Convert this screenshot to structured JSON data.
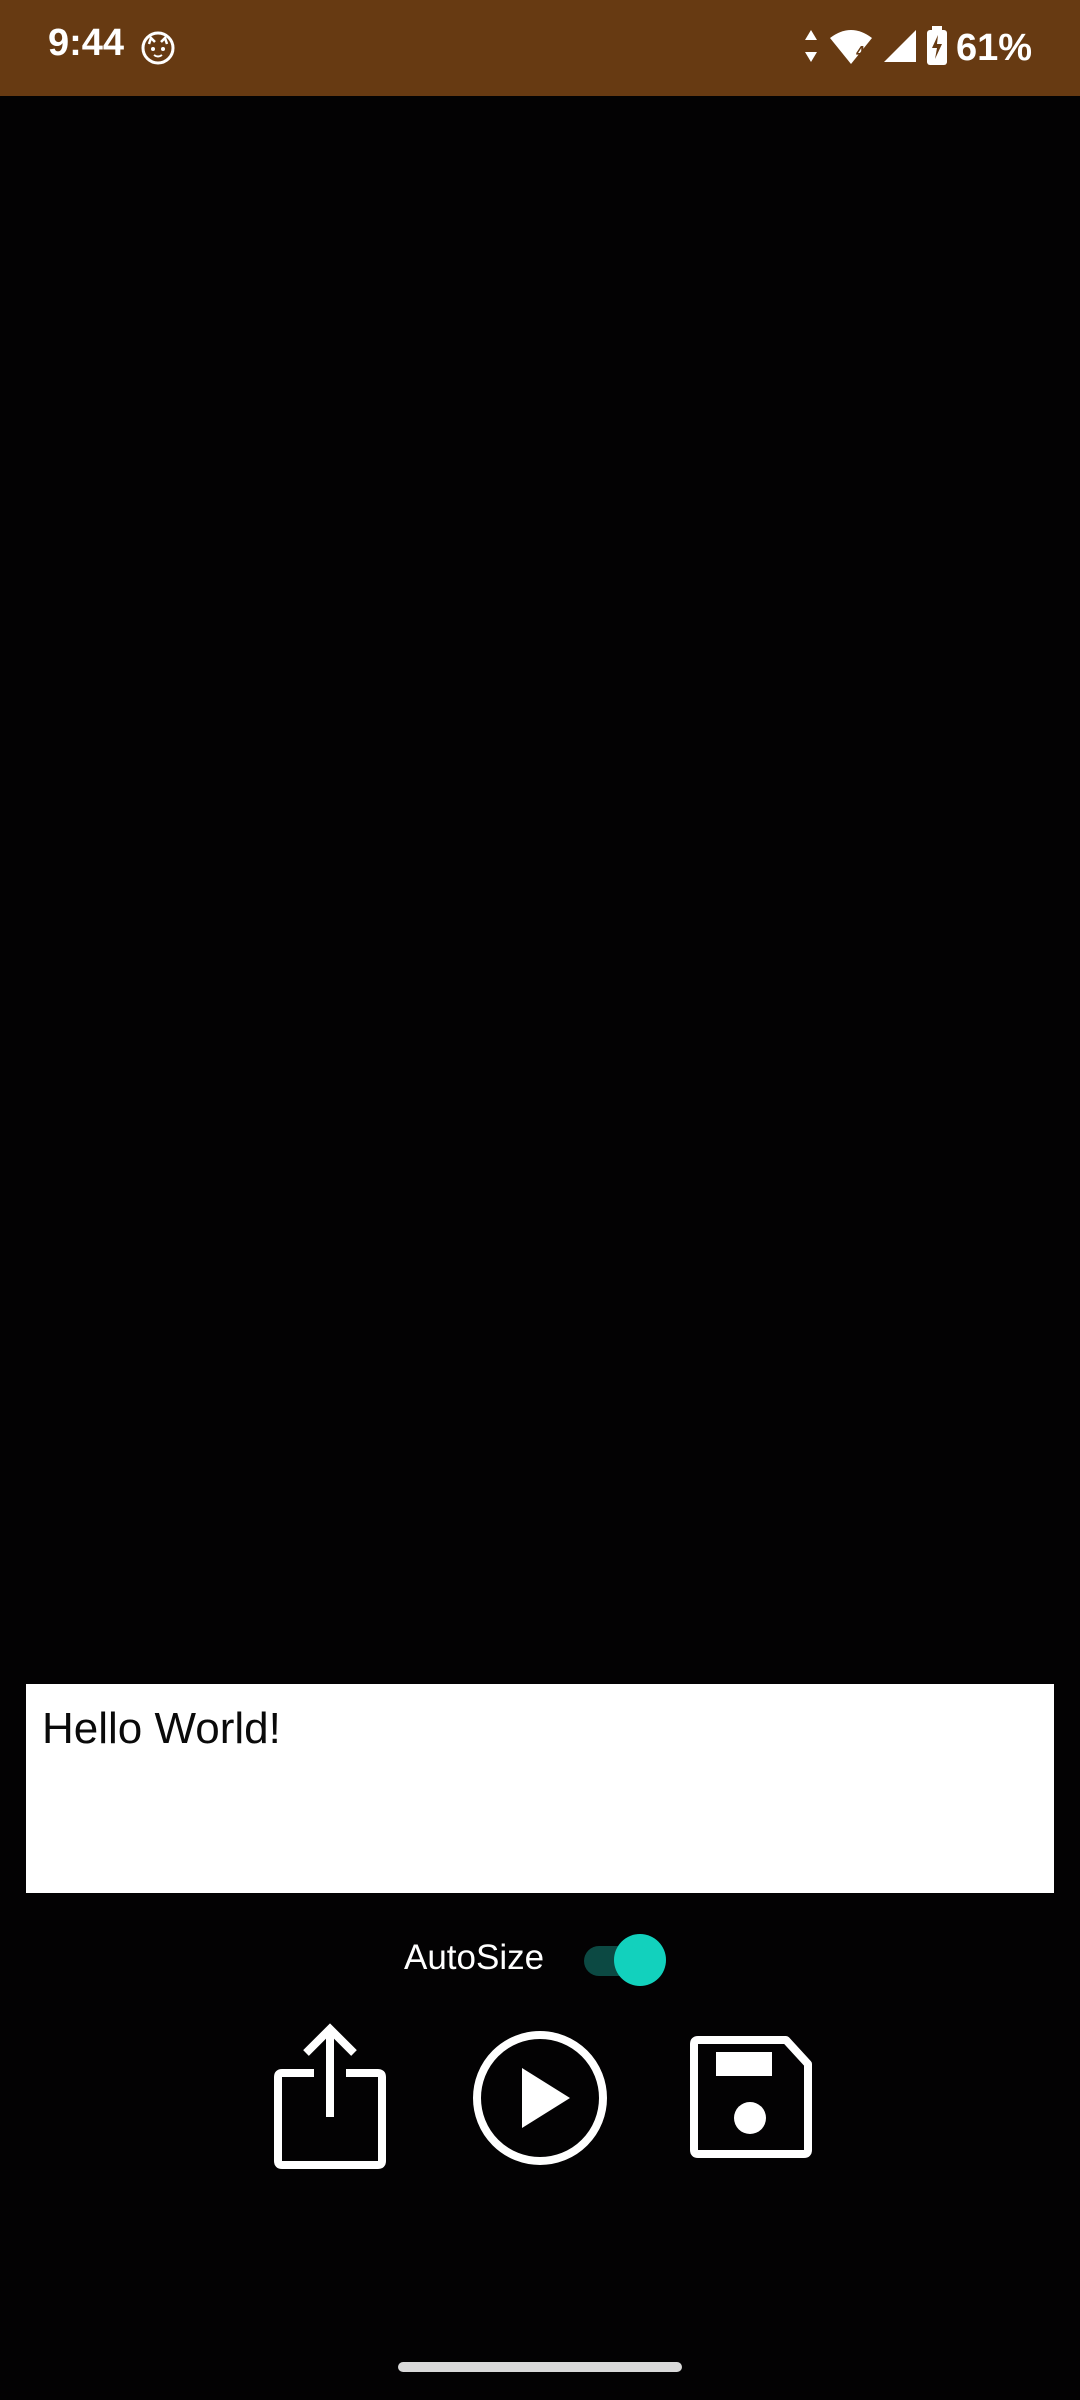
{
  "status_bar": {
    "time": "9:44",
    "app_icon": "cat-face-icon",
    "network_icon": "data-arrows-icon",
    "wifi_icon": "wifi-icon",
    "wifi_badge": "4",
    "signal_icon": "cell-signal-icon",
    "battery_icon": "battery-charging-icon",
    "battery_percent": "61%",
    "background_color": "#673a12"
  },
  "editor": {
    "text_value": "Hello World!",
    "background_color": "#030203"
  },
  "controls": {
    "autosize_label": "AutoSize",
    "autosize_enabled": true,
    "accent_color": "#12d1bd",
    "share_icon": "share-icon",
    "play_icon": "play-icon",
    "save_icon": "save-icon"
  }
}
